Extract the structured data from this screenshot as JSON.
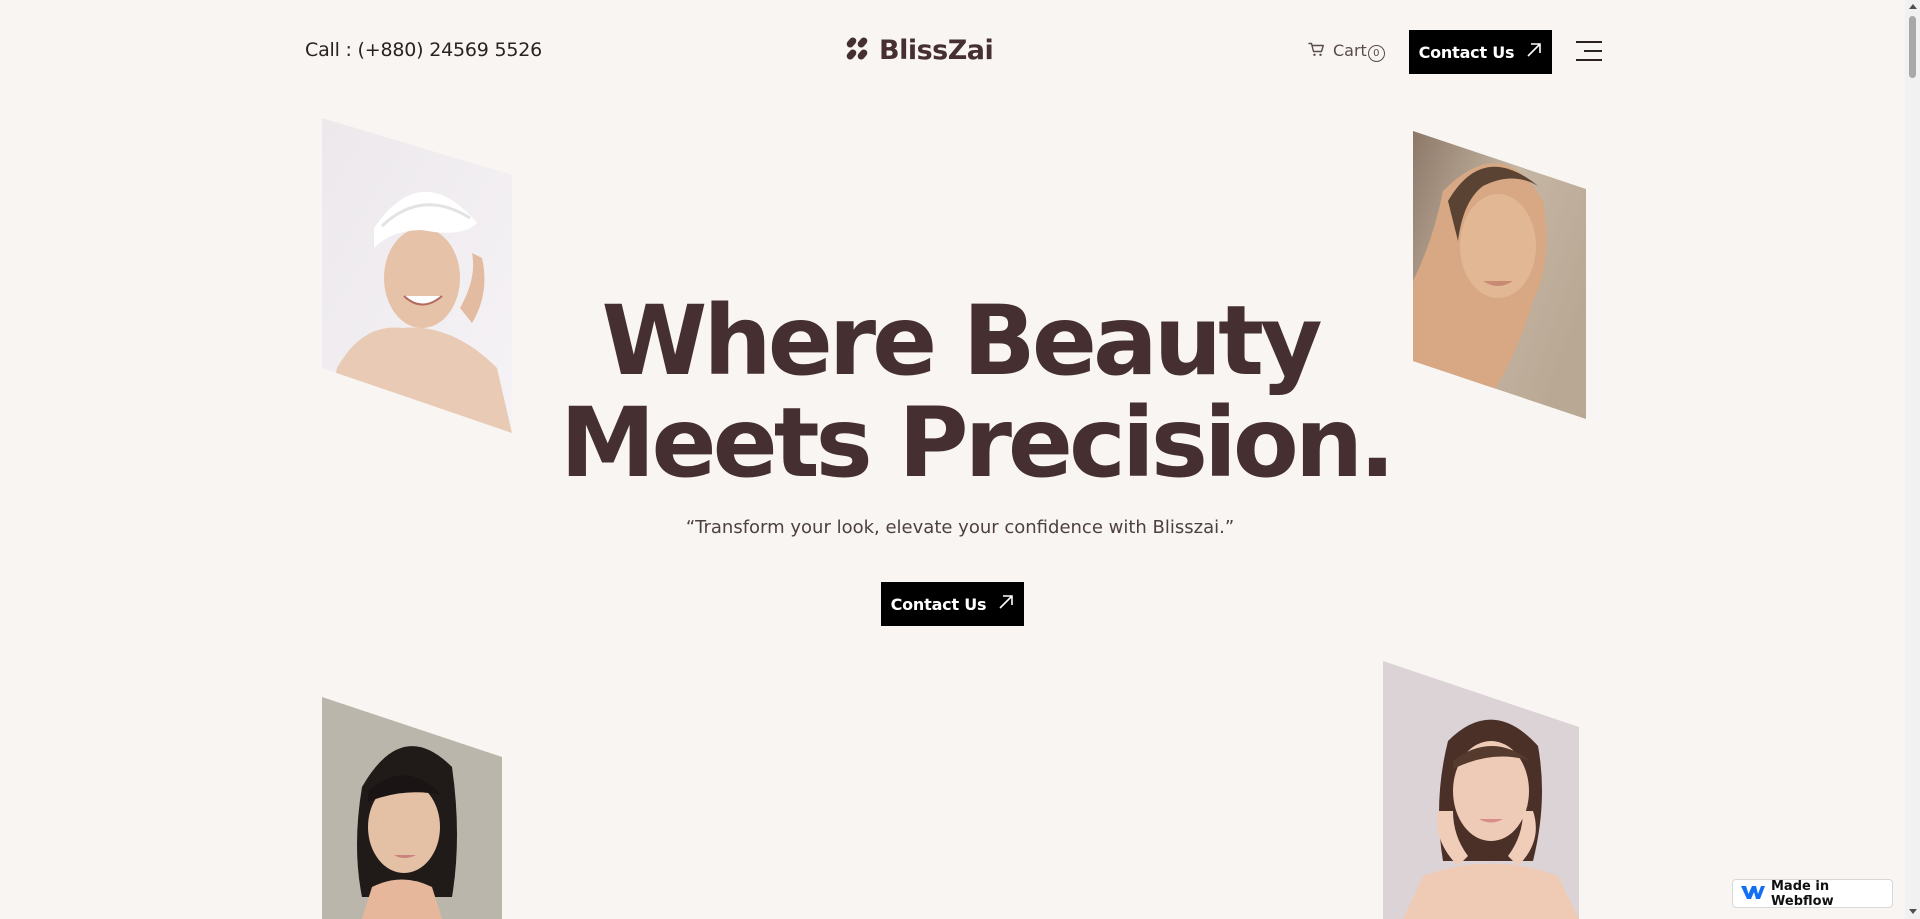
{
  "header": {
    "phone": "Call : (+880) 24569 5526",
    "logo_text": "BlissZai",
    "cart_label": "Cart",
    "cart_count": "0",
    "contact_button": "Contact Us"
  },
  "hero": {
    "title_line1": "Where Beauty",
    "title_line2": "Meets Precision.",
    "tagline": "“Transform your look, elevate your confidence with Blisszai.”",
    "contact_button": "Contact Us"
  },
  "badge": {
    "label": "Made in Webflow"
  },
  "icons": {
    "logo": "blisszai-logo-icon",
    "cart": "cart-icon",
    "arrow": "arrow-up-right-icon",
    "menu": "hamburger-menu-icon",
    "webflow": "webflow-logo-icon"
  },
  "colors": {
    "background": "#f8f5f2",
    "heading": "#452f31",
    "button": "#000000",
    "button_text": "#ffffff"
  }
}
